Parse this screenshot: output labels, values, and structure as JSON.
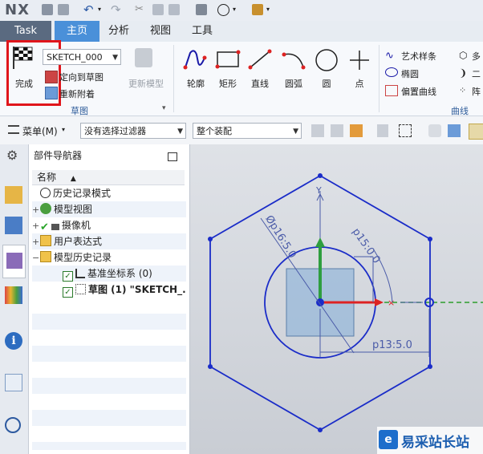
{
  "app": {
    "logo": "NX"
  },
  "tabs": [
    {
      "label": "Task"
    },
    {
      "label": "主页"
    },
    {
      "label": "分析"
    },
    {
      "label": "视图"
    },
    {
      "label": "工具"
    }
  ],
  "ribbon": {
    "finish_label": "完成",
    "sketch_select_value": "SKETCH_000",
    "orient_to_sketch": "定向到草图",
    "reattach": "重新附着",
    "update_model": "更新模型",
    "group_sketch": "草图",
    "curve_tools": [
      {
        "label": "轮廓"
      },
      {
        "label": "矩形"
      },
      {
        "label": "直线"
      },
      {
        "label": "圆弧"
      },
      {
        "label": "圆"
      },
      {
        "label": "点"
      }
    ],
    "right_tools": [
      {
        "label": "艺术样条"
      },
      {
        "label": "椭圆"
      },
      {
        "label": "偏置曲线"
      }
    ],
    "group_curve": "曲线",
    "far_right_tools": [
      "多",
      "二",
      "阵"
    ]
  },
  "toolbar": {
    "menu_label": "菜单(M)",
    "filter_value": "没有选择过滤器",
    "assembly_value": "整个装配"
  },
  "navigator": {
    "title": "部件导航器",
    "column_header": "名称",
    "rows": [
      {
        "label": "历史记录模式"
      },
      {
        "label": "模型视图"
      },
      {
        "label": "摄像机"
      },
      {
        "label": "用户表达式"
      },
      {
        "label": "模型历史记录"
      },
      {
        "label": "基准坐标系 (0)"
      },
      {
        "label": "草图 (1) \"SKETCH_..."
      }
    ]
  },
  "sketch": {
    "dimensions": [
      {
        "label": "Øp16:5.0"
      },
      {
        "label": "p15:0.0"
      },
      {
        "label": "p13:5.0"
      }
    ],
    "axis_y_label": "Y"
  },
  "watermark": {
    "text": "易采站长站"
  },
  "colors": {
    "accent_tab": "#4a90d9",
    "highlight": "#e0151b",
    "sketch_curve": "#1a2cc8",
    "dimension": "#4a5ba8"
  }
}
